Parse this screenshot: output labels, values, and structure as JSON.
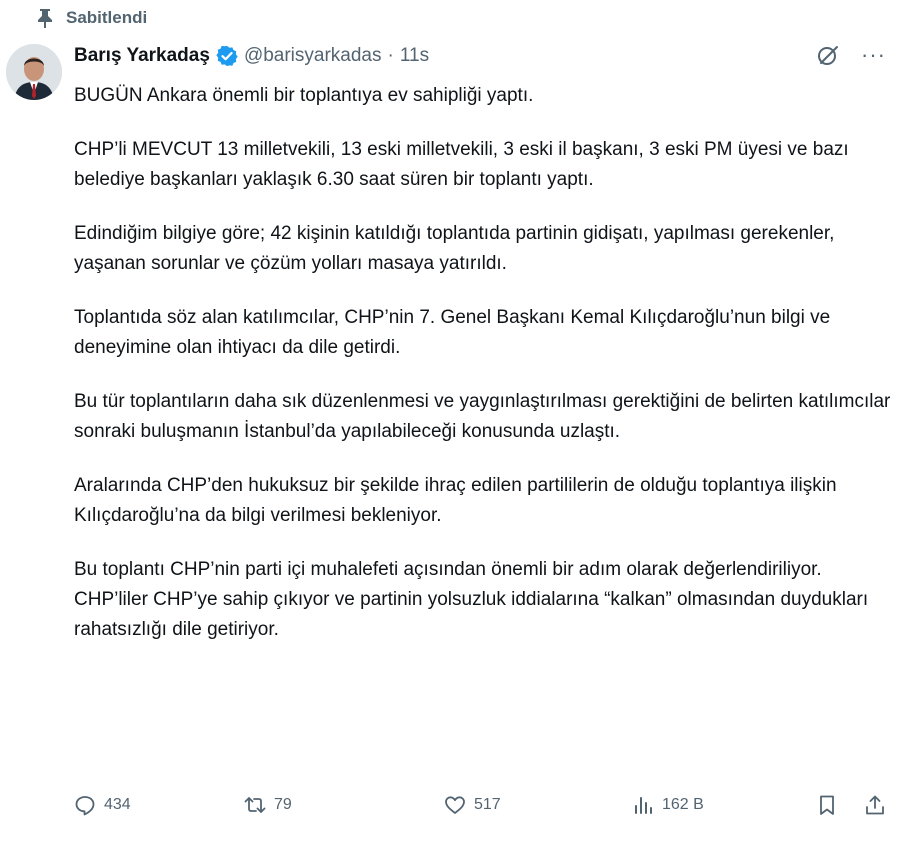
{
  "pinned": {
    "label": "Sabitlendi",
    "icon": "pin-icon"
  },
  "author": {
    "name": "Barış Yarkadaş",
    "handle": "@barisyarkadas",
    "separator": "·",
    "time": "11s",
    "verified_color": "#1d9bf0"
  },
  "tweet": {
    "paragraphs": [
      "BUGÜN Ankara önemli bir toplantıya ev sahipliği yaptı.",
      "CHP’li MEVCUT 13 milletvekili, 13 eski milletvekili, 3 eski il başkanı, 3 eski PM üyesi ve bazı belediye başkanları yaklaşık 6.30 saat süren bir toplantı yaptı.",
      "Edindiğim bilgiye göre; 42 kişinin katıldığı toplantıda partinin gidişatı, yapılması gerekenler, yaşanan sorunlar ve çözüm yolları masaya yatırıldı.",
      "Toplantıda söz alan katılımcılar, CHP’nin 7. Genel Başkanı Kemal Kılıçdaroğlu’nun bilgi ve deneyimine olan ihtiyacı da dile getirdi.",
      "Bu tür toplantıların daha sık düzenlenmesi ve yaygınlaştırılması gerektiğini de belirten katılımcılar sonraki buluşmanın İstanbul’da yapılabileceği konusunda uzlaştı.",
      "Aralarında CHP’den hukuksuz bir şekilde ihraç edilen partililerin de olduğu toplantıya ilişkin Kılıçdaroğlu’na da bilgi verilmesi bekleniyor.",
      "Bu toplantı CHP’nin parti içi muhalefeti açısından önemli bir adım olarak değerlendiriliyor.  CHP’liler CHP’ye sahip çıkıyor ve partinin yolsuzluk iddialarına “kalkan” olmasından duydukları rahatsızlığı dile getiriyor."
    ]
  },
  "actions": {
    "replies": "434",
    "retweets": "79",
    "likes": "517",
    "views": "162 B"
  },
  "colors": {
    "muted": "#536471",
    "text": "#0f1419",
    "accent": "#1d9bf0"
  }
}
